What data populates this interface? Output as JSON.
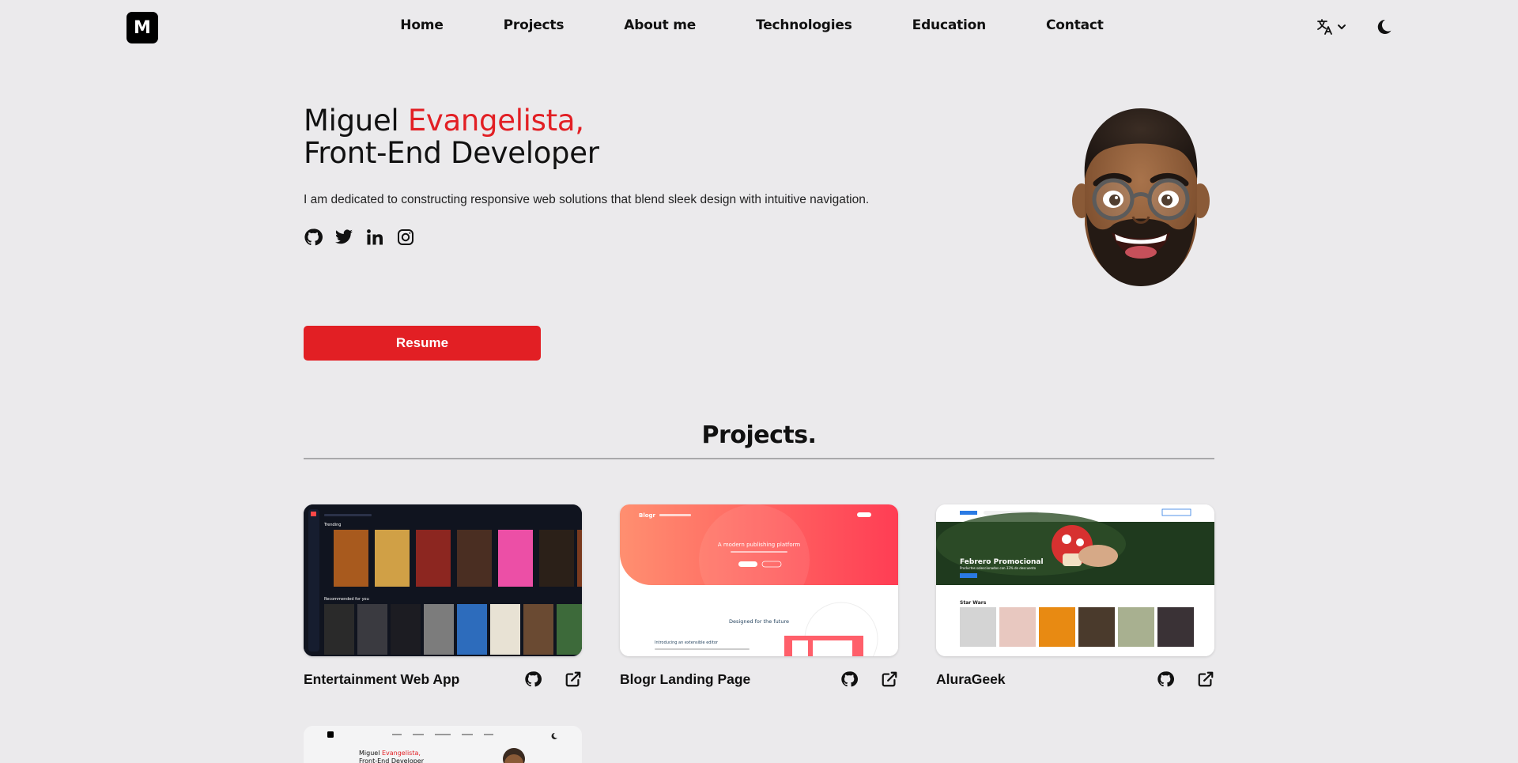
{
  "nav": {
    "logo_letter": "M",
    "links": [
      "Home",
      "Projects",
      "About me",
      "Technologies",
      "Education",
      "Contact"
    ],
    "language_icon": "translate-icon",
    "theme_icon": "moon-icon"
  },
  "hero": {
    "name_first": "Miguel ",
    "name_last": "Evangelista,",
    "role": "Front-End Developer",
    "description": "I am dedicated to constructing responsive web solutions that blend sleek design with intuitive navigation.",
    "socials": [
      "github-icon",
      "twitter-icon",
      "linkedin-icon",
      "instagram-icon"
    ],
    "resume_label": "Resume",
    "accent_color": "#e21f24"
  },
  "projects": {
    "title": "Projects.",
    "items": [
      {
        "name": "Entertainment Web App",
        "preview": {
          "row1": "Trending",
          "row2": "Recommended for you"
        }
      },
      {
        "name": "Blogr Landing Page",
        "preview": {
          "brand": "Blogr",
          "headline": "A modern publishing platform",
          "subhead": "Designed for the future",
          "section": "Introducing an extensible editor"
        }
      },
      {
        "name": "AluraGeek",
        "preview": {
          "banner_title": "Febrero Promocional",
          "banner_sub": "Productos seleccionados con 33% de descuento",
          "section": "Star Wars"
        }
      },
      {
        "name": "",
        "preview": {
          "name_first": "Miguel ",
          "name_last": "Evangelista,",
          "role": "Front-End Developer"
        }
      }
    ]
  }
}
